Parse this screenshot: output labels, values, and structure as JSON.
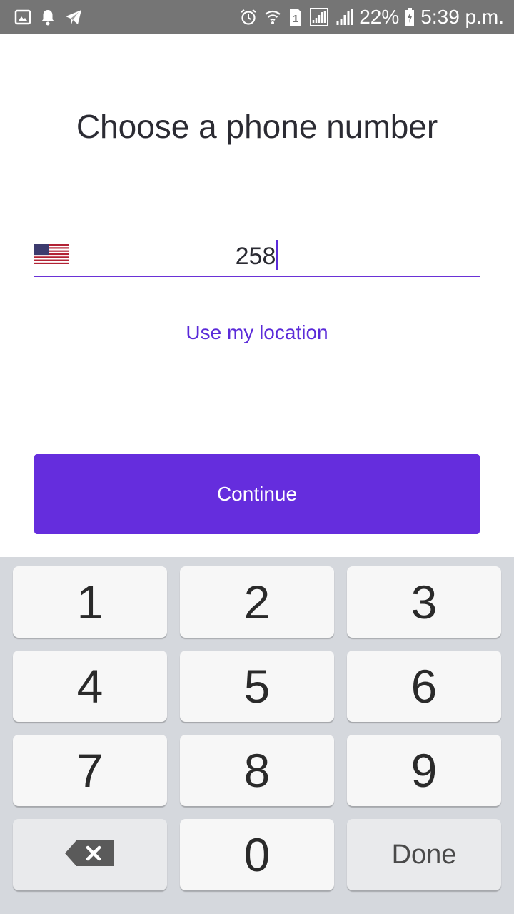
{
  "status_bar": {
    "battery_percent": "22%",
    "time": "5:39 p.m.",
    "sim_slot": "1",
    "icons": [
      "gallery-icon",
      "notification-bell-icon",
      "telegram-icon",
      "alarm-icon",
      "wifi-icon",
      "sim-1-icon",
      "signal-icon",
      "signal-icon",
      "battery-charging-icon"
    ]
  },
  "page": {
    "title": "Choose a phone number"
  },
  "phone_field": {
    "country_flag": "us-flag-icon",
    "value": "258"
  },
  "location_link": {
    "label": "Use my location"
  },
  "continue_button": {
    "label": "Continue"
  },
  "keypad": {
    "keys": [
      "1",
      "2",
      "3",
      "4",
      "5",
      "6",
      "7",
      "8",
      "9",
      "0"
    ],
    "backspace_icon": "backspace-icon",
    "done_label": "Done"
  },
  "colors": {
    "accent": "#652ddd",
    "link": "#5b2bd9",
    "status_bar": "#757575",
    "keypad_bg": "#d5d8dd"
  }
}
